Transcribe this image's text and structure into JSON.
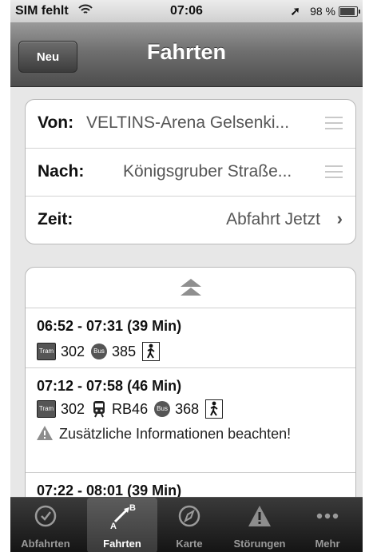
{
  "status_bar": {
    "carrier": "SIM fehlt",
    "time": "07:06",
    "battery": "98 %"
  },
  "nav": {
    "left_button": "Neu",
    "title": "Fahrten"
  },
  "form": {
    "from_label": "Von:",
    "from_value": "VELTINS-Arena Gelsenki...",
    "to_label": "Nach:",
    "to_value": "Königsgruber Straße...",
    "time_label": "Zeit:",
    "time_value": "Abfahrt Jetzt"
  },
  "trips": [
    {
      "times": "06:52 - 07:31 (39 Min)",
      "legs": [
        {
          "type": "Tram",
          "icon": "tram-icon",
          "line": "302"
        },
        {
          "type": "Bus",
          "icon": "bus-icon",
          "line": "385"
        },
        {
          "type": "walk",
          "icon": "walk-icon",
          "line": ""
        }
      ]
    },
    {
      "times": "07:12 - 07:58 (46 Min)",
      "legs": [
        {
          "type": "Tram",
          "icon": "tram-icon",
          "line": "302"
        },
        {
          "type": "train",
          "icon": "train-icon",
          "line": "RB46"
        },
        {
          "type": "Bus",
          "icon": "bus-icon",
          "line": "368"
        },
        {
          "type": "walk",
          "icon": "walk-icon",
          "line": ""
        }
      ],
      "info": "Zusätzliche Informationen beachten!"
    },
    {
      "times": "07:22 - 08:01 (39 Min)"
    }
  ],
  "tabs": [
    {
      "label": "Abfahrten",
      "icon": "clock-icon"
    },
    {
      "label": "Fahrten",
      "icon": "route-arrow-icon",
      "selected": true,
      "icon_text_a": "A",
      "icon_text_b": "B"
    },
    {
      "label": "Karte",
      "icon": "compass-icon"
    },
    {
      "label": "Störungen",
      "icon": "warning-icon"
    },
    {
      "label": "Mehr",
      "icon": "more-dots-icon"
    }
  ],
  "colors": {
    "nav_bar": "#5e5e5e",
    "background": "#e7e7e7",
    "tab_bar": "#1e1e1e"
  }
}
